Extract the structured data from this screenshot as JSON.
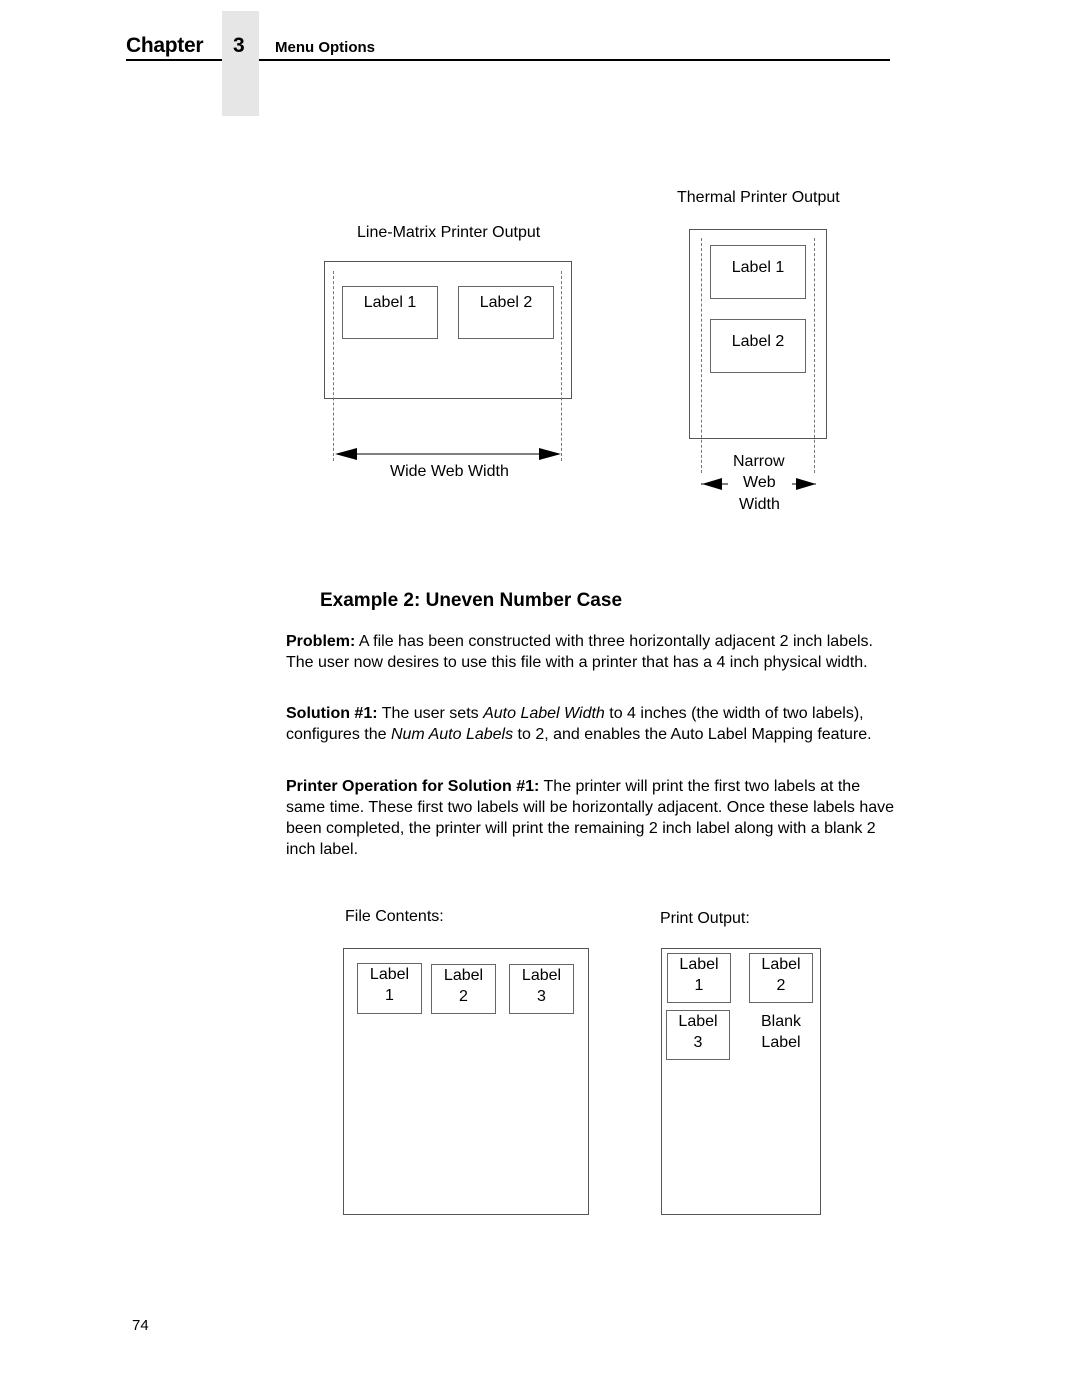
{
  "header": {
    "chapter_word": "Chapter",
    "chapter_number": "3",
    "section_title": "Menu Options"
  },
  "figure1": {
    "line_matrix": {
      "title": "Line-Matrix Printer Output",
      "labels": [
        "Label 1",
        "Label 2"
      ],
      "width_caption": "Wide Web Width"
    },
    "thermal": {
      "title": "Thermal Printer Output",
      "labels": [
        "Label 1",
        "Label 2"
      ],
      "width_caption": [
        "Narrow",
        "Web",
        "Width"
      ]
    }
  },
  "example": {
    "heading": "Example 2: Uneven Number Case",
    "problem": {
      "lead": "Problem:",
      "text": " A file has been constructed with three horizontally adjacent 2 inch labels. The user now desires to use this file with a printer that has a 4 inch physical width."
    },
    "solution": {
      "lead": "Solution #1:",
      "t1": " The user sets ",
      "i1": "Auto Label Width",
      "t2": " to 4 inches (the width of two labels), configures the ",
      "i2": "Num Auto Labels",
      "t3": " to 2, and enables the Auto Label Mapping feature."
    },
    "operation": {
      "lead": "Printer Operation for Solution #1:",
      "text": " The printer will print the first two labels at the same time. These first two labels will be horizontally adjacent. Once these labels have been completed, the printer will print the remaining 2 inch label along with a blank 2 inch label."
    }
  },
  "figure2": {
    "file_contents": {
      "title": "File Contents:",
      "labels": [
        {
          "line1": "Label",
          "line2": "1"
        },
        {
          "line1": "Label",
          "line2": "2"
        },
        {
          "line1": "Label",
          "line2": "3"
        }
      ]
    },
    "print_output": {
      "title": "Print Output:",
      "labels": [
        {
          "line1": "Label",
          "line2": "1"
        },
        {
          "line1": "Label",
          "line2": "2"
        },
        {
          "line1": "Label",
          "line2": "3"
        },
        {
          "line1": "Blank",
          "line2": "Label"
        }
      ]
    }
  },
  "footer": {
    "page_number": "74"
  }
}
